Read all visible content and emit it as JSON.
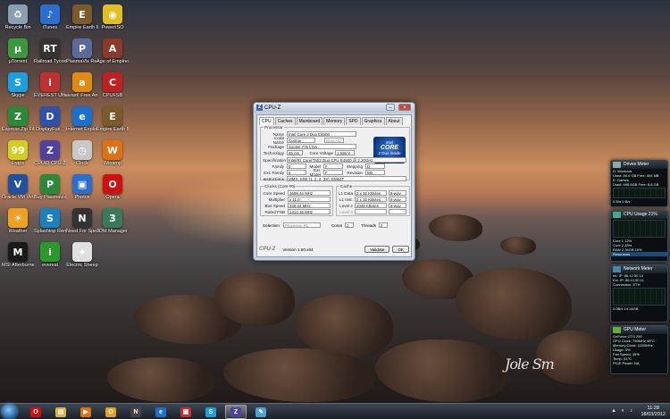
{
  "desktop_icons": [
    {
      "label": "Recycle Bin",
      "color": "#8aa0b0",
      "glyph": "♻"
    },
    {
      "label": "iTunes",
      "color": "#2a6fd0",
      "glyph": "♪"
    },
    {
      "label": "Empire Earth II",
      "color": "#7a5a2a",
      "glyph": "E"
    },
    {
      "label": "PowerISO",
      "color": "#e0c020",
      "glyph": "◉"
    },
    {
      "label": "µTorrent",
      "color": "#3a9a3a",
      "glyph": "µ"
    },
    {
      "label": "Railroad Tycoon 3",
      "color": "#333333",
      "glyph": "RT"
    },
    {
      "label": "PlasmaVis ReadMe",
      "color": "#5a6a9a",
      "glyph": "P"
    },
    {
      "label": "Age of Empires II",
      "color": "#8a3a2a",
      "glyph": "A"
    },
    {
      "label": "Skype",
      "color": "#18a0e0",
      "glyph": "S"
    },
    {
      "label": "EVEREST Ultima...",
      "color": "#c03030",
      "glyph": "i"
    },
    {
      "label": "avast! Free Antivirus",
      "color": "#e08a10",
      "glyph": "a"
    },
    {
      "label": "CPUFSB",
      "color": "#c02020",
      "glyph": "C"
    },
    {
      "label": "Express Zip File Compr...",
      "color": "#2a8a3a",
      "glyph": "Z"
    },
    {
      "label": "DisplayFus...",
      "color": "#3050b0",
      "glyph": "D"
    },
    {
      "label": "Internet Explorer (64...",
      "color": "#1a70d0",
      "glyph": "e"
    },
    {
      "label": "Empire Earth II - The Art...",
      "color": "#7a5a2a",
      "glyph": "E"
    },
    {
      "label": "Fraps",
      "color": "#d0d020",
      "glyph": "99"
    },
    {
      "label": "CPUID CPU-Z",
      "color": "#5040a0",
      "glyph": "Z"
    },
    {
      "label": "Clock",
      "color": "#c8c8c8",
      "glyph": "◷"
    },
    {
      "label": "Winamp",
      "color": "#e07010",
      "glyph": "W"
    },
    {
      "label": "Oracle VM VirtualBox",
      "color": "#2050a0",
      "glyph": "V"
    },
    {
      "label": "Buy Plasmavis...",
      "color": "#2a8a3a",
      "glyph": "P"
    },
    {
      "label": "Photos",
      "color": "#2a6fd0",
      "glyph": "▣"
    },
    {
      "label": "Opera",
      "color": "#d01010",
      "glyph": "O"
    },
    {
      "label": "Weather",
      "color": "#f0a020",
      "glyph": "☀"
    },
    {
      "label": "Splashtop Remote...",
      "color": "#1a80c0",
      "glyph": "S"
    },
    {
      "label": "Need For Speed World",
      "color": "#333333",
      "glyph": "N"
    },
    {
      "label": "3DM Manager 2",
      "color": "#3a7a5a",
      "glyph": "3"
    },
    {
      "label": "MSI Afterburner",
      "color": "#1a1a1a",
      "glyph": "M"
    },
    {
      "label": "everest",
      "color": "#2a9a2a",
      "glyph": "i"
    },
    {
      "label": "Electric Sheep",
      "color": "#e0e0e0",
      "glyph": "✦"
    }
  ],
  "cpuz": {
    "title": "CPU-Z",
    "tabs": [
      "CPU",
      "Caches",
      "Mainboard",
      "Memory",
      "SPD",
      "Graphics",
      "About"
    ],
    "processor_group": "Processor",
    "name_label": "Name",
    "name": "Intel Core 2 Duo E4500",
    "codename_label": "Code Name",
    "codename": "Conroe",
    "brand_id_label": "Brand ID",
    "package_label": "Package",
    "package": "Socket 775 LGA",
    "technology_label": "Technology",
    "technology": "65 nm",
    "core_voltage_label": "Core Voltage",
    "core_voltage": "1.536 V",
    "spec_label": "Specification",
    "spec": "Intel(R) Core(TM)2 Duo CPU    E4500  @ 2.20GHz",
    "family_label": "Family",
    "family": "6",
    "model_label": "Model",
    "model": "F",
    "stepping_label": "Stepping",
    "stepping": "D",
    "ext_family_label": "Ext. Family",
    "ext_family": "6",
    "ext_model_label": "Ext. Model",
    "ext_model": "F",
    "revision_label": "Revision",
    "revision": "M0",
    "instructions_label": "Instructions",
    "instructions": "MMX, SSE (1, 2, 3, 3S), EM64T",
    "clocks_group": "Clocks (Core #0)",
    "core_speed_label": "Core Speed",
    "core_speed": "3608.44 MHz",
    "multiplier_label": "Multiplier",
    "multiplier": "x 11.0",
    "bus_speed_label": "Bus Speed",
    "bus_speed": "328.04 MHz",
    "rated_fsb_label": "Rated FSB",
    "rated_fsb": "1312.16 MHz",
    "cache_group": "Cache",
    "l1d_label": "L1 Data",
    "l1d": "2 x 32 KBytes",
    "l1d_way": "8-way",
    "l1i_label": "L1 Inst.",
    "l1i": "2 x 32 KBytes",
    "l1i_way": "8-way",
    "l2_label": "Level 2",
    "l2": "2048 KBytes",
    "l2_way": "8-way",
    "l3_label": "Level 3",
    "selection_label": "Selection",
    "selection": "Processor #1",
    "cores_label": "Cores",
    "cores": "2",
    "threads_label": "Threads",
    "threads": "2",
    "version": "Version 1.60.x64",
    "validate": "Validate",
    "ok": "OK",
    "intel_brand": "intel",
    "intel_core": "CORE",
    "intel_sub": "2 Duo inside"
  },
  "gadgets": {
    "drives": {
      "title": "Drives Meter",
      "lines": [
        "D: Windows",
        "Used: 84.0 GB  Free: 404 MB",
        "E: Games",
        "Used: 698.6GB  Free: 8.8 GB"
      ],
      "readout": "0 B/s   0 B/s"
    },
    "cpu": {
      "title": "CPU Usage  21%",
      "lines": [
        "Core 1   12%",
        "Core 2   28%",
        "RAM   2,34GB  16%"
      ],
      "readout": "Resources"
    },
    "network": {
      "title": "Network Meter",
      "lines": [
        "Int. IP: 86.12.50.14",
        "Ext. IP: 86.12.50.11",
        "Connection: ETH"
      ],
      "readout": "0.0B/s   14.14GB"
    },
    "gpu": {
      "title": "GPU Meter",
      "lines": [
        "GeForce GTS 250",
        "GPU Clock: 750MHz  48°C",
        "Memory Clock: 1100MHz",
        "Usage: 0%",
        "Fan Speed: 35%",
        "Temp: 51°C"
      ],
      "readout": "PCIE Power: NA"
    }
  },
  "taskbar": {
    "items": [
      {
        "name": "opera",
        "color": "#d01010",
        "glyph": "O"
      },
      {
        "name": "explorer",
        "color": "#e0b040",
        "glyph": "▤"
      },
      {
        "name": "mediaplayer",
        "color": "#e07010",
        "glyph": "▶"
      },
      {
        "name": "outlook",
        "color": "#e0a020",
        "glyph": "O"
      },
      {
        "name": "nfs",
        "color": "#444444",
        "glyph": "N"
      },
      {
        "name": "ie",
        "color": "#1a70d0",
        "glyph": "e"
      },
      {
        "name": "photos",
        "color": "#c03030",
        "glyph": "▣"
      },
      {
        "name": "skype",
        "color": "#18a0e0",
        "glyph": "S"
      },
      {
        "name": "cpuz",
        "color": "#5040a0",
        "glyph": "Z"
      },
      {
        "name": "paint",
        "color": "#4aa0d0",
        "glyph": "✎"
      }
    ],
    "time": "11:28",
    "date": "18/03/2012"
  },
  "signature": "Jole Sm"
}
